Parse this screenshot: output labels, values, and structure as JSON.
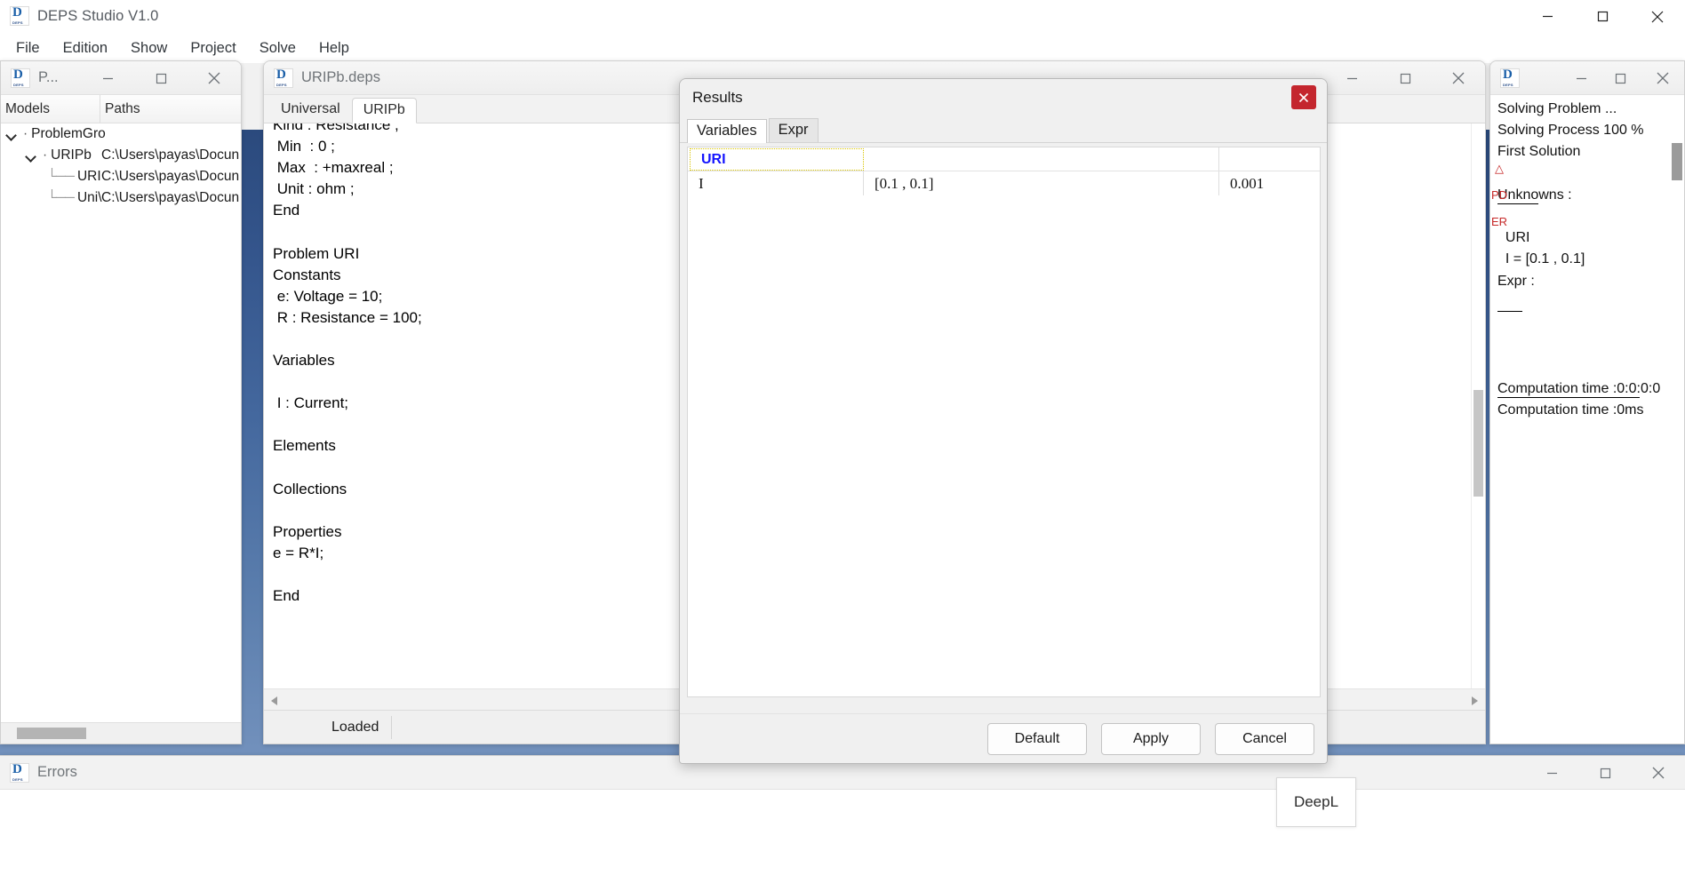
{
  "app": {
    "title": "DEPS Studio V1.0",
    "logo_icon": "deps-logo-icon",
    "window_controls": {
      "minimize": "minimize-icon",
      "maximize": "maximize-icon",
      "close": "close-icon"
    },
    "menu": [
      {
        "label": "File"
      },
      {
        "label": "Edition"
      },
      {
        "label": "Show"
      },
      {
        "label": "Project"
      },
      {
        "label": "Solve"
      },
      {
        "label": "Help"
      }
    ]
  },
  "project_window": {
    "title": "P...",
    "columns": {
      "models": "Models",
      "paths": "Paths"
    },
    "tree": [
      {
        "label": "ProblemGro",
        "path": "",
        "depth": 0,
        "expanded": true
      },
      {
        "label": "URIPb",
        "path": "C:\\Users\\payas\\Docun",
        "depth": 1,
        "expanded": true
      },
      {
        "label": "URI",
        "path": "C:\\Users\\payas\\Docun",
        "depth": 2,
        "expanded": false
      },
      {
        "label": "Uni\\",
        "path": "C:\\Users\\payas\\Docun",
        "depth": 2,
        "expanded": false
      }
    ]
  },
  "editor_window": {
    "title": "URIPb.deps",
    "tabs": [
      {
        "label": "Universal",
        "active": false
      },
      {
        "label": "URIPb",
        "active": true
      }
    ],
    "code": "Kind : Resistance ;\n Min  : 0 ;\n Max  : +maxreal ;\n Unit : ohm ;\nEnd\n\nProblem URI\nConstants\n e: Voltage = 10;\n R : Resistance = 100;\n\nVariables\n\n I : Current;\n\nElements\n\nCollections\n\nProperties\ne = R*I;\n\nEnd",
    "status": "Loaded"
  },
  "solver_window": {
    "title": "",
    "log": "Solving Problem ...\nSolving Process 100 %\nFirst Solution\n\nUnknowns :\n\n  URI\n  I = [0.1 , 0.1]\nExpr :\n\n\n\n\nComputation time :0:0:0:0\nComputation time :0ms"
  },
  "errors_window": {
    "title": "Errors"
  },
  "results_dialog": {
    "title": "Results",
    "close_icon": "close-icon",
    "tabs": [
      {
        "label": "Variables",
        "active": true
      },
      {
        "label": "Expr",
        "active": false
      }
    ],
    "rows": [
      {
        "type": "group",
        "name": "URI",
        "col2": "",
        "col3": ""
      },
      {
        "type": "item",
        "name": "I",
        "col2": "[0.1 , 0.1]",
        "col3": "0.001"
      }
    ],
    "buttons": [
      {
        "label": "Default"
      },
      {
        "label": "Apply"
      },
      {
        "label": "Cancel"
      }
    ]
  },
  "deepl_popup": {
    "label": "DeepL"
  },
  "colors": {
    "accent_blue": "#1414ff",
    "close_red": "#c4262e",
    "highlight_yellow": "#d9c400",
    "title_gray": "#707579"
  }
}
